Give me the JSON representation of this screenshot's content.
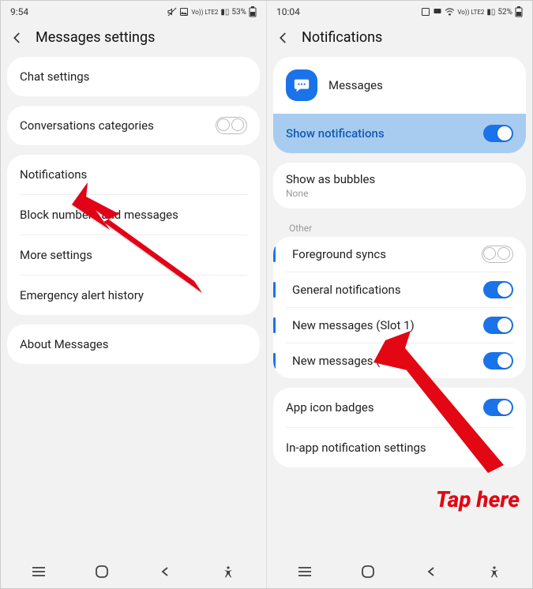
{
  "left": {
    "status": {
      "time": "9:54",
      "battery": "53%",
      "net": "Vo)) LTE2"
    },
    "title": "Messages settings",
    "card1": [
      {
        "label": "Chat settings"
      }
    ],
    "card2": [
      {
        "label": "Conversations categories",
        "toggle": "dbl-off"
      }
    ],
    "card3": [
      {
        "label": "Notifications"
      },
      {
        "label": "Block numbers and messages"
      },
      {
        "label": "More settings"
      },
      {
        "label": "Emergency alert history"
      }
    ],
    "card4": [
      {
        "label": "About Messages"
      }
    ]
  },
  "right": {
    "status": {
      "time": "10:04",
      "battery": "52%",
      "net": "Vo)) LTE2"
    },
    "title": "Notifications",
    "app": {
      "name": "Messages"
    },
    "row_show": {
      "label": "Show notifications",
      "toggle": "on"
    },
    "row_bubbles": {
      "label": "Show as bubbles",
      "sub": "None"
    },
    "section_other": "Other",
    "other": [
      {
        "label": "Foreground syncs",
        "toggle": "dbl-off",
        "bar": true
      },
      {
        "label": "General notifications",
        "toggle": "on",
        "bar": true
      },
      {
        "label": "New messages (Slot 1)",
        "toggle": "on",
        "bar": true
      },
      {
        "label": "New messages (SIM2)",
        "toggle": "on",
        "bar": true
      }
    ],
    "card_last": [
      {
        "label": "App icon badges",
        "toggle": "on"
      },
      {
        "label": "In-app notification settings"
      }
    ]
  },
  "annotation": "Tap here"
}
